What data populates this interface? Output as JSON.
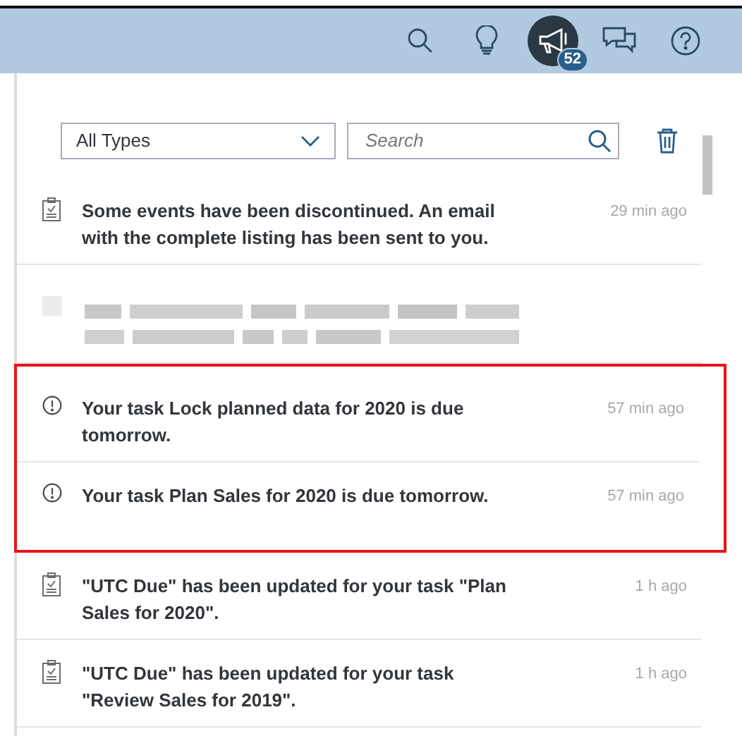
{
  "shell_bar": {
    "actions": [
      {
        "kind": "search",
        "selected": false
      },
      {
        "kind": "ideas",
        "selected": false
      },
      {
        "kind": "notifications",
        "selected": true,
        "badge": "52"
      },
      {
        "kind": "chat",
        "selected": false
      },
      {
        "kind": "help",
        "selected": false
      }
    ]
  },
  "filters": {
    "type_select": {
      "value": "All Types"
    },
    "search": {
      "placeholder": "Search"
    }
  },
  "notifications": [
    {
      "kind": "task",
      "text": "Some events have been discontinued. An email with the complete listing has been sent to you.",
      "time": "29 min ago",
      "highlighted": false
    },
    {
      "kind": "redacted",
      "highlighted": false
    },
    {
      "kind": "alert",
      "text": "Your task Lock planned data for 2020 is due tomorrow.",
      "time": "57 min ago",
      "highlighted": true
    },
    {
      "kind": "alert",
      "text": "Your task Plan Sales for 2020 is due tomorrow.",
      "time": "57 min ago",
      "highlighted": true
    },
    {
      "kind": "task",
      "text": "\"UTC Due\" has been updated for your task \"Plan Sales for 2020\".",
      "time": "1 h ago",
      "highlighted": false
    },
    {
      "kind": "task",
      "text": "\"UTC Due\" has been updated for your task \"Review Sales for 2019\".",
      "time": "1 h ago",
      "highlighted": false
    }
  ]
}
